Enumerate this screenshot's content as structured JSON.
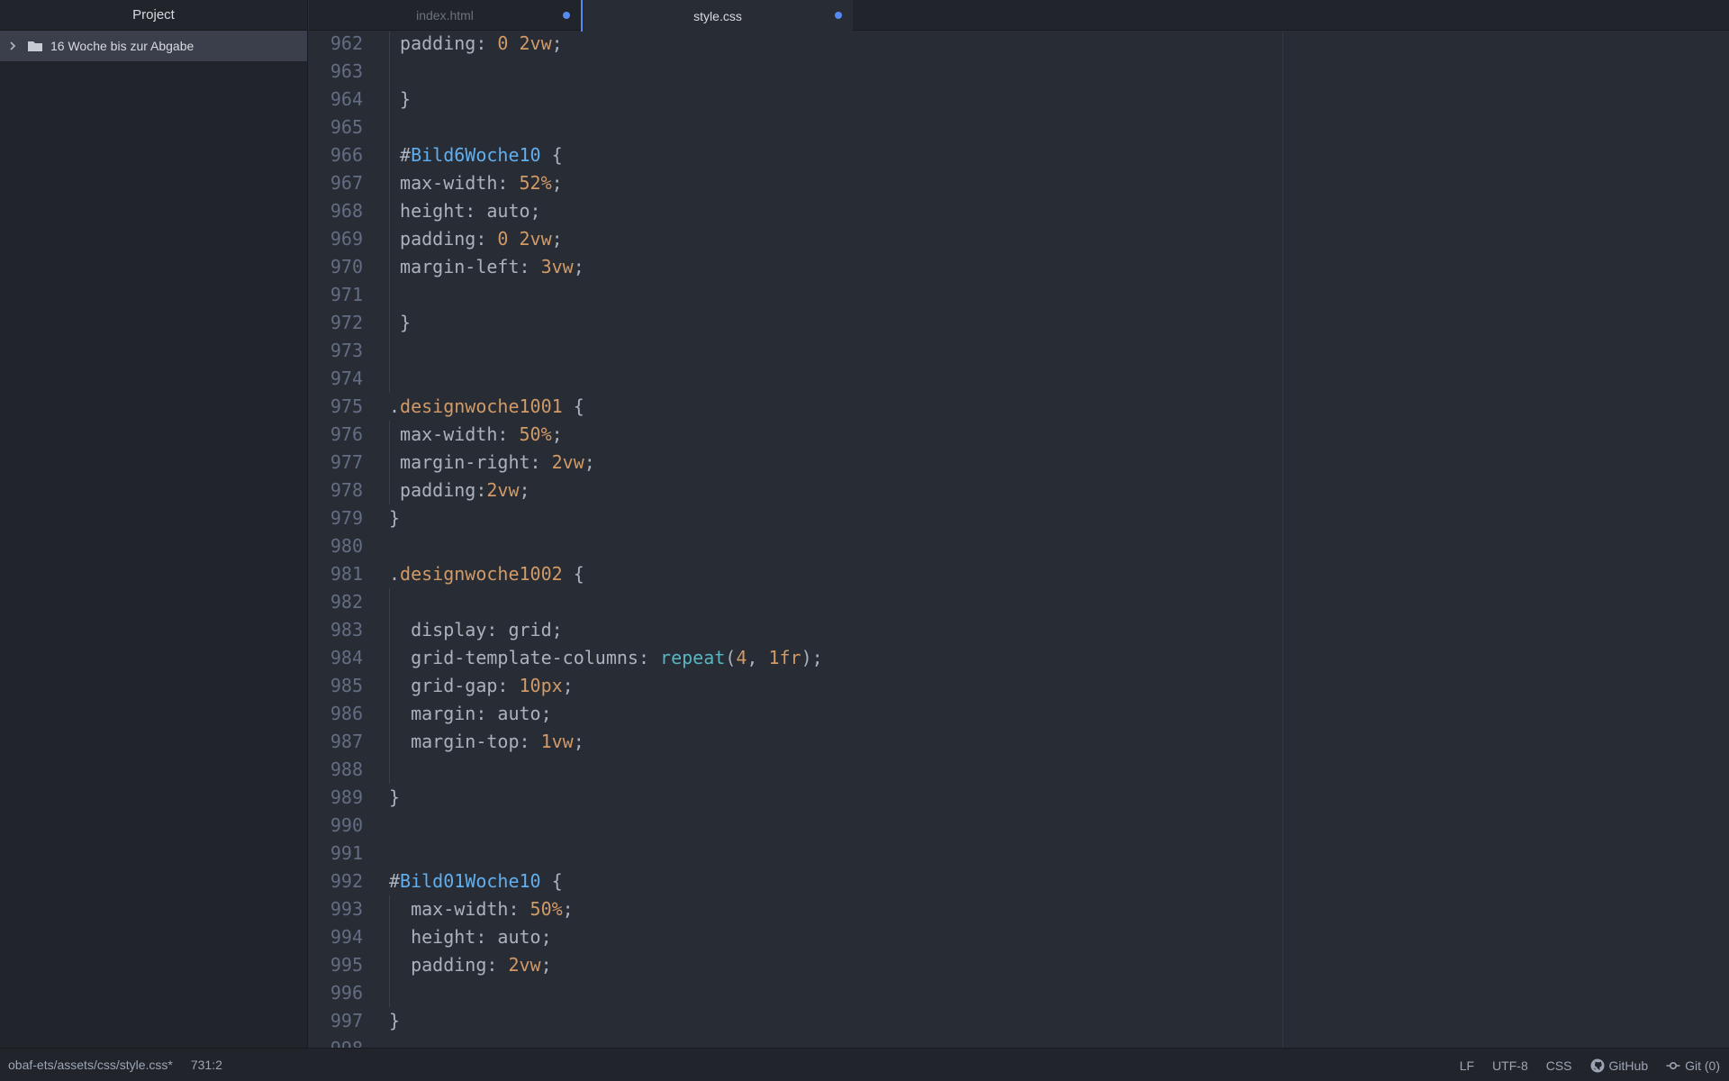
{
  "sidebar": {
    "title": "Project",
    "tree": [
      {
        "label": "16 Woche bis zur Abgabe",
        "icon": "folder-icon"
      }
    ]
  },
  "tabs": [
    {
      "label": "index.html",
      "modified": true,
      "active": false
    },
    {
      "label": "style.css",
      "modified": true,
      "active": true
    }
  ],
  "editor": {
    "lines": [
      {
        "n": "962",
        "tokens": [
          {
            "t": " padding: ",
            "c": "punct"
          },
          {
            "t": "0 2vw",
            "c": "num"
          },
          {
            "t": ";",
            "c": "punct"
          }
        ],
        "guide": true
      },
      {
        "n": "963",
        "tokens": [],
        "guide": true
      },
      {
        "n": "964",
        "tokens": [
          {
            "t": " }",
            "c": "punct"
          }
        ],
        "guide": true
      },
      {
        "n": "965",
        "tokens": [],
        "guide": true
      },
      {
        "n": "966",
        "tokens": [
          {
            "t": " #",
            "c": "punct"
          },
          {
            "t": "Bild6Woche10",
            "c": "id"
          },
          {
            "t": " {",
            "c": "punct"
          }
        ],
        "guide": true
      },
      {
        "n": "967",
        "tokens": [
          {
            "t": " max-width: ",
            "c": "punct"
          },
          {
            "t": "52%",
            "c": "num"
          },
          {
            "t": ";",
            "c": "punct"
          }
        ],
        "guide": true
      },
      {
        "n": "968",
        "tokens": [
          {
            "t": " height: auto;",
            "c": "punct"
          }
        ],
        "guide": true
      },
      {
        "n": "969",
        "tokens": [
          {
            "t": " padding: ",
            "c": "punct"
          },
          {
            "t": "0 2vw",
            "c": "num"
          },
          {
            "t": ";",
            "c": "punct"
          }
        ],
        "guide": true
      },
      {
        "n": "970",
        "tokens": [
          {
            "t": " margin-left: ",
            "c": "punct"
          },
          {
            "t": "3vw",
            "c": "num"
          },
          {
            "t": ";",
            "c": "punct"
          }
        ],
        "guide": true
      },
      {
        "n": "971",
        "tokens": [],
        "guide": true
      },
      {
        "n": "972",
        "tokens": [
          {
            "t": " }",
            "c": "punct"
          }
        ],
        "guide": true
      },
      {
        "n": "973",
        "tokens": [],
        "guide": true
      },
      {
        "n": "974",
        "tokens": [],
        "guide": true
      },
      {
        "n": "975",
        "tokens": [
          {
            "t": ".",
            "c": "punct"
          },
          {
            "t": "designwoche1001",
            "c": "sel"
          },
          {
            "t": " {",
            "c": "punct"
          }
        ],
        "guide": false
      },
      {
        "n": "976",
        "tokens": [
          {
            "t": " max-width: ",
            "c": "punct"
          },
          {
            "t": "50%",
            "c": "num"
          },
          {
            "t": ";",
            "c": "punct"
          }
        ],
        "guide": true
      },
      {
        "n": "977",
        "tokens": [
          {
            "t": " margin-right: ",
            "c": "punct"
          },
          {
            "t": "2vw",
            "c": "num"
          },
          {
            "t": ";",
            "c": "punct"
          }
        ],
        "guide": true
      },
      {
        "n": "978",
        "tokens": [
          {
            "t": " padding:",
            "c": "punct"
          },
          {
            "t": "2vw",
            "c": "num"
          },
          {
            "t": ";",
            "c": "punct"
          }
        ],
        "guide": true
      },
      {
        "n": "979",
        "tokens": [
          {
            "t": "}",
            "c": "punct"
          }
        ],
        "guide": false
      },
      {
        "n": "980",
        "tokens": [],
        "guide": false
      },
      {
        "n": "981",
        "tokens": [
          {
            "t": ".",
            "c": "punct"
          },
          {
            "t": "designwoche1002",
            "c": "sel"
          },
          {
            "t": " {",
            "c": "punct"
          }
        ],
        "guide": false
      },
      {
        "n": "982",
        "tokens": [],
        "guide": true
      },
      {
        "n": "983",
        "tokens": [
          {
            "t": "  display: grid;",
            "c": "punct"
          }
        ],
        "guide": true
      },
      {
        "n": "984",
        "tokens": [
          {
            "t": "  grid-template-columns: ",
            "c": "punct"
          },
          {
            "t": "repeat",
            "c": "fn"
          },
          {
            "t": "(",
            "c": "punct"
          },
          {
            "t": "4",
            "c": "num"
          },
          {
            "t": ", ",
            "c": "punct"
          },
          {
            "t": "1fr",
            "c": "num"
          },
          {
            "t": ");",
            "c": "punct"
          }
        ],
        "guide": true
      },
      {
        "n": "985",
        "tokens": [
          {
            "t": "  grid-gap: ",
            "c": "punct"
          },
          {
            "t": "10px",
            "c": "num"
          },
          {
            "t": ";",
            "c": "punct"
          }
        ],
        "guide": true
      },
      {
        "n": "986",
        "tokens": [
          {
            "t": "  margin: auto;",
            "c": "punct"
          }
        ],
        "guide": true
      },
      {
        "n": "987",
        "tokens": [
          {
            "t": "  margin-top: ",
            "c": "punct"
          },
          {
            "t": "1vw",
            "c": "num"
          },
          {
            "t": ";",
            "c": "punct"
          }
        ],
        "guide": true
      },
      {
        "n": "988",
        "tokens": [],
        "guide": true
      },
      {
        "n": "989",
        "tokens": [
          {
            "t": "}",
            "c": "punct"
          }
        ],
        "guide": false
      },
      {
        "n": "990",
        "tokens": [],
        "guide": false
      },
      {
        "n": "991",
        "tokens": [],
        "guide": false
      },
      {
        "n": "992",
        "tokens": [
          {
            "t": "#",
            "c": "punct"
          },
          {
            "t": "Bild01Woche10",
            "c": "id"
          },
          {
            "t": " {",
            "c": "punct"
          }
        ],
        "guide": false
      },
      {
        "n": "993",
        "tokens": [
          {
            "t": "  max-width: ",
            "c": "punct"
          },
          {
            "t": "50%",
            "c": "num"
          },
          {
            "t": ";",
            "c": "punct"
          }
        ],
        "guide": true
      },
      {
        "n": "994",
        "tokens": [
          {
            "t": "  height: auto;",
            "c": "punct"
          }
        ],
        "guide": true
      },
      {
        "n": "995",
        "tokens": [
          {
            "t": "  padding: ",
            "c": "punct"
          },
          {
            "t": "2vw",
            "c": "num"
          },
          {
            "t": ";",
            "c": "punct"
          }
        ],
        "guide": true
      },
      {
        "n": "996",
        "tokens": [],
        "guide": true
      },
      {
        "n": "997",
        "tokens": [
          {
            "t": "}",
            "c": "punct"
          }
        ],
        "guide": false
      },
      {
        "n": "998",
        "tokens": [],
        "guide": false
      }
    ]
  },
  "statusbar": {
    "file_path": "obaf-ets/assets/css/style.css*",
    "cursor": "731:2",
    "line_ending": "LF",
    "encoding": "UTF-8",
    "grammar": "CSS",
    "github": "GitHub",
    "git": "Git (0)"
  },
  "colors": {
    "accent": "#568af2",
    "selector": "#d19a66",
    "id": "#61afef",
    "number": "#d19a66",
    "function": "#56b6c2"
  }
}
